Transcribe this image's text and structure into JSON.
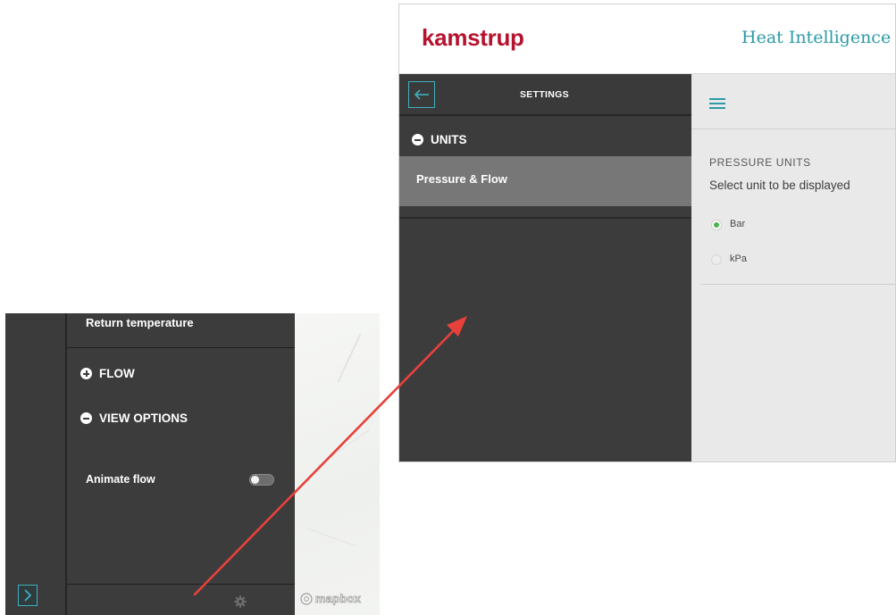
{
  "left_screenshot": {
    "return_temperature_label": "Return temperature",
    "flow_section_label": "FLOW",
    "view_options_section_label": "VIEW OPTIONS",
    "animate_flow_label": "Animate flow",
    "animate_flow_on": false,
    "map_attribution": "mapbox"
  },
  "right_screenshot": {
    "brand": "kamstrup",
    "app_title": "Heat Intelligence",
    "settings_title": "SETTINGS",
    "units_section_label": "UNITS",
    "active_menu_item": "Pressure & Flow",
    "pressure_units_heading": "PRESSURE UNITS",
    "pressure_units_description": "Select unit to be displayed",
    "options": [
      {
        "label": "Bar",
        "selected": true
      },
      {
        "label": "kPa",
        "selected": false
      }
    ]
  },
  "colors": {
    "brand_red": "#b5122e",
    "accent_teal": "#2c9aa6",
    "radio_green": "#49b44a",
    "arrow_red": "#e8413b",
    "panel_dark": "#3c3c3c"
  }
}
